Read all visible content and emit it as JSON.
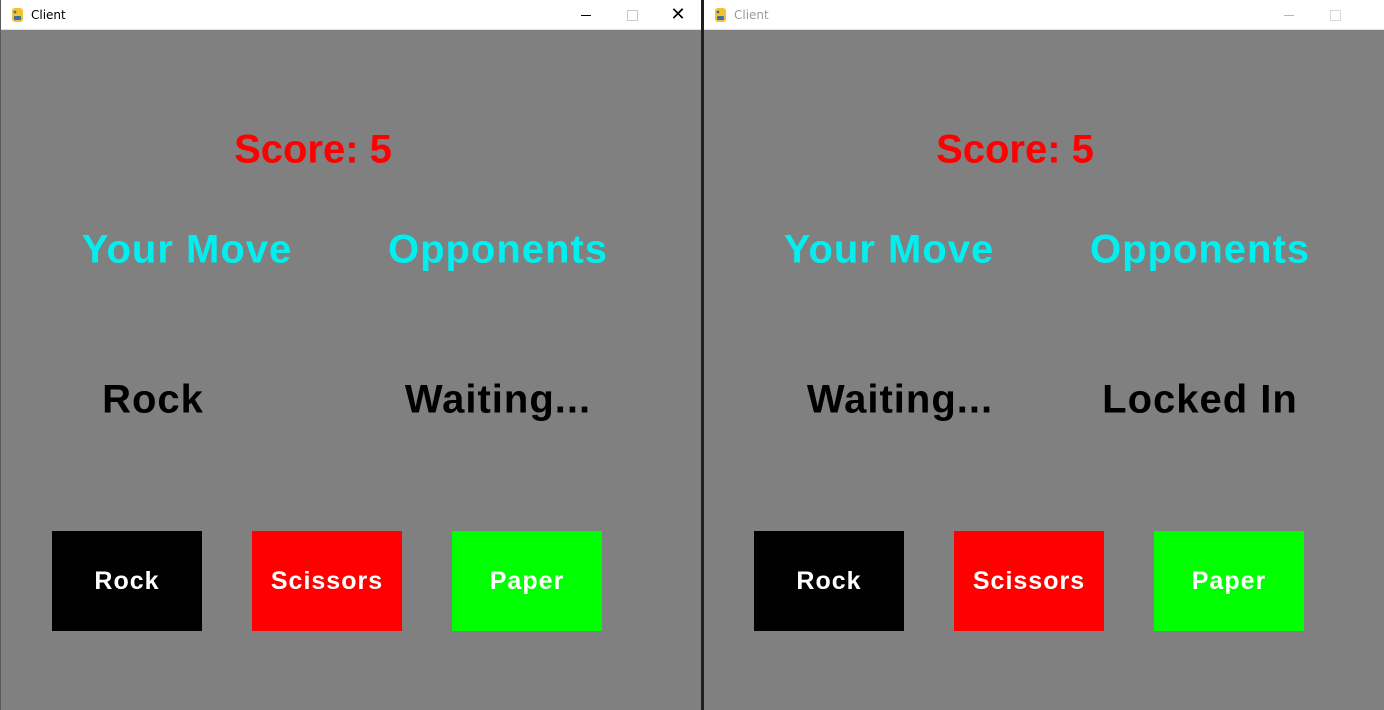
{
  "windows": [
    {
      "title": "Client",
      "active": true,
      "score_text": "Score: 5",
      "your_move_heading": "Your Move",
      "opponents_heading": "Opponents",
      "your_move_value": "Rock",
      "opponent_value": "Waiting...",
      "buttons": [
        {
          "label": "Rock",
          "color": "#000000"
        },
        {
          "label": "Scissors",
          "color": "#ff0000"
        },
        {
          "label": "Paper",
          "color": "#00ff00"
        }
      ],
      "controls": {
        "minimize": "minimize-icon",
        "maximize": "maximize-icon",
        "close": "close-icon"
      }
    },
    {
      "title": "Client",
      "active": false,
      "score_text": "Score: 5",
      "your_move_heading": "Your Move",
      "opponents_heading": "Opponents",
      "your_move_value": "Waiting...",
      "opponent_value": "Locked In",
      "buttons": [
        {
          "label": "Rock",
          "color": "#000000"
        },
        {
          "label": "Scissors",
          "color": "#ff0000"
        },
        {
          "label": "Paper",
          "color": "#00ff00"
        }
      ],
      "controls": {
        "minimize": "minimize-icon",
        "maximize": "maximize-icon"
      }
    }
  ],
  "colors": {
    "game_background": "#808080",
    "score": "#ff0000",
    "heading": "#00f0f0",
    "move_text": "#000000",
    "button_text": "#ffffff"
  }
}
